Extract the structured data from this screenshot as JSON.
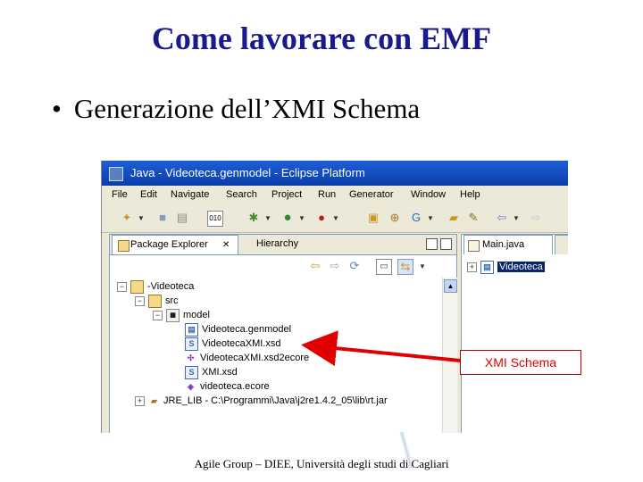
{
  "slide": {
    "title": "Come lavorare con EMF",
    "bullet": "Generazione dell’XMI Schema",
    "footer": "Agile Group – DIEE, Università degli studi di Cagliari"
  },
  "window": {
    "title": "Java - Videoteca.genmodel - Eclipse Platform"
  },
  "menu": [
    "File",
    "Edit",
    "Navigate",
    "Search",
    "Project",
    "Run",
    "Generator",
    "Window",
    "Help"
  ],
  "toolbar_icons": [
    "new-wizard-icon",
    "save-icon",
    "print-icon",
    "binary-icon",
    "debug-icon",
    "run-icon",
    "external-tools-icon",
    "new-java-project-icon",
    "new-package-icon",
    "new-class-icon",
    "open-type-icon",
    "search-icon",
    "back-icon",
    "forward-icon"
  ],
  "package_explorer": {
    "tab_label": "Package Explorer",
    "tab_close": "✕",
    "second_tab": "Hierarchy",
    "tree": [
      {
        "label": "-Videoteca",
        "level": 0,
        "icon": "project-icon",
        "expanded": true
      },
      {
        "label": "src",
        "level": 1,
        "icon": "source-folder-icon",
        "expanded": true
      },
      {
        "label": "model",
        "level": 2,
        "icon": "package-icon",
        "expanded": true
      },
      {
        "label": "Videoteca.genmodel",
        "level": 3,
        "icon": "genmodel-icon"
      },
      {
        "label": "VideotecaXMI.xsd",
        "level": 3,
        "icon": "xsd-file-icon"
      },
      {
        "label": "VideotecaXMI.xsd2ecore",
        "level": 3,
        "icon": "xsd2ecore-icon"
      },
      {
        "label": "XMI.xsd",
        "level": 3,
        "icon": "xsd-file-icon"
      },
      {
        "label": "videoteca.ecore",
        "level": 3,
        "icon": "ecore-file-icon"
      },
      {
        "label": "JRE_LIB - C:\\Programmi\\Java\\j2re1.4.2_05\\lib\\rt.jar",
        "level": 1,
        "icon": "jar-icon",
        "expanded": false
      }
    ]
  },
  "editor": {
    "tab_label": "Main.java",
    "tree_item": "Videoteca"
  },
  "callout": {
    "label": "XMI Schema",
    "color": "#e00000"
  },
  "colors": {
    "title": "#1a1a8c",
    "titlebar": "#0a3ea8",
    "arrow": "#e00000"
  }
}
